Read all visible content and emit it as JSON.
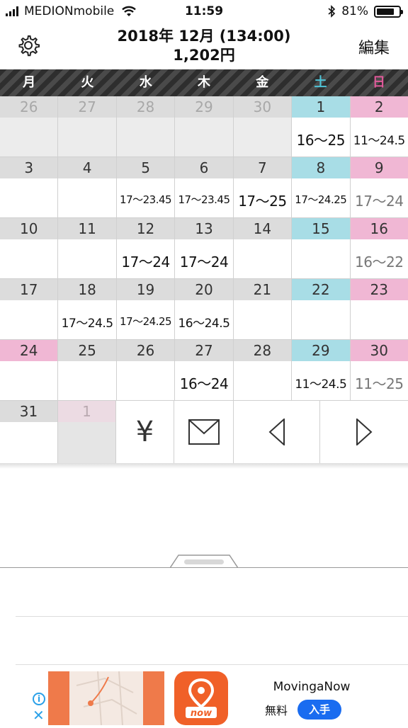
{
  "status": {
    "carrier": "MEDIONmobile",
    "time": "11:59",
    "battery": "81%"
  },
  "header": {
    "title": "2018年 12月 (134:00)",
    "subtitle": "1,202円",
    "edit_label": "編集"
  },
  "weekdays": [
    {
      "label": "月",
      "color": "#ffffff"
    },
    {
      "label": "火",
      "color": "#ffffff"
    },
    {
      "label": "水",
      "color": "#ffffff"
    },
    {
      "label": "木",
      "color": "#ffffff"
    },
    {
      "label": "金",
      "color": "#ffffff"
    },
    {
      "label": "土",
      "color": "#4fc3d6"
    },
    {
      "label": "日",
      "color": "#e05a9a"
    }
  ],
  "colors": {
    "saturday": "#a8dde6",
    "sunday": "#f0b7d4",
    "weekday": "#dcdcdc"
  },
  "weeks": [
    [
      {
        "date": "26",
        "muted": true
      },
      {
        "date": "27",
        "muted": true
      },
      {
        "date": "28",
        "muted": true
      },
      {
        "date": "29",
        "muted": true
      },
      {
        "date": "30",
        "muted": true
      },
      {
        "date": "1",
        "shift": "16〜25"
      },
      {
        "date": "2",
        "shift": "11〜24.5",
        "size": "m"
      }
    ],
    [
      {
        "date": "3"
      },
      {
        "date": "4"
      },
      {
        "date": "5",
        "shift": "17〜23.45",
        "size": "s"
      },
      {
        "date": "6",
        "shift": "17〜23.45",
        "size": "s"
      },
      {
        "date": "7",
        "shift": "17〜25"
      },
      {
        "date": "8",
        "shift": "17〜24.25",
        "size": "s"
      },
      {
        "date": "9",
        "shift": "17〜24",
        "gray": true
      }
    ],
    [
      {
        "date": "10"
      },
      {
        "date": "11"
      },
      {
        "date": "12",
        "shift": "17〜24"
      },
      {
        "date": "13",
        "shift": "17〜24"
      },
      {
        "date": "14"
      },
      {
        "date": "15"
      },
      {
        "date": "16",
        "shift": "16〜22",
        "gray": true
      }
    ],
    [
      {
        "date": "17"
      },
      {
        "date": "18",
        "shift": "17〜24.5",
        "size": "m"
      },
      {
        "date": "19",
        "shift": "17〜24.25",
        "size": "s"
      },
      {
        "date": "20",
        "shift": "16〜24.5",
        "size": "m"
      },
      {
        "date": "21"
      },
      {
        "date": "22"
      },
      {
        "date": "23"
      }
    ],
    [
      {
        "date": "24",
        "sunday_style": true
      },
      {
        "date": "25"
      },
      {
        "date": "26"
      },
      {
        "date": "27",
        "shift": "16〜24"
      },
      {
        "date": "28"
      },
      {
        "date": "29",
        "shift": "11〜24.5",
        "size": "m"
      },
      {
        "date": "30",
        "shift": "11〜25",
        "gray": true
      }
    ]
  ],
  "last_row": {
    "date_31": "31",
    "next_date": "1",
    "yen_symbol": "¥"
  },
  "ad": {
    "app_name": "MovingaNow",
    "price_label": "無料",
    "get_label": "入手",
    "icon_text": "now",
    "info_symbol": "i",
    "close_symbol": "✕"
  }
}
